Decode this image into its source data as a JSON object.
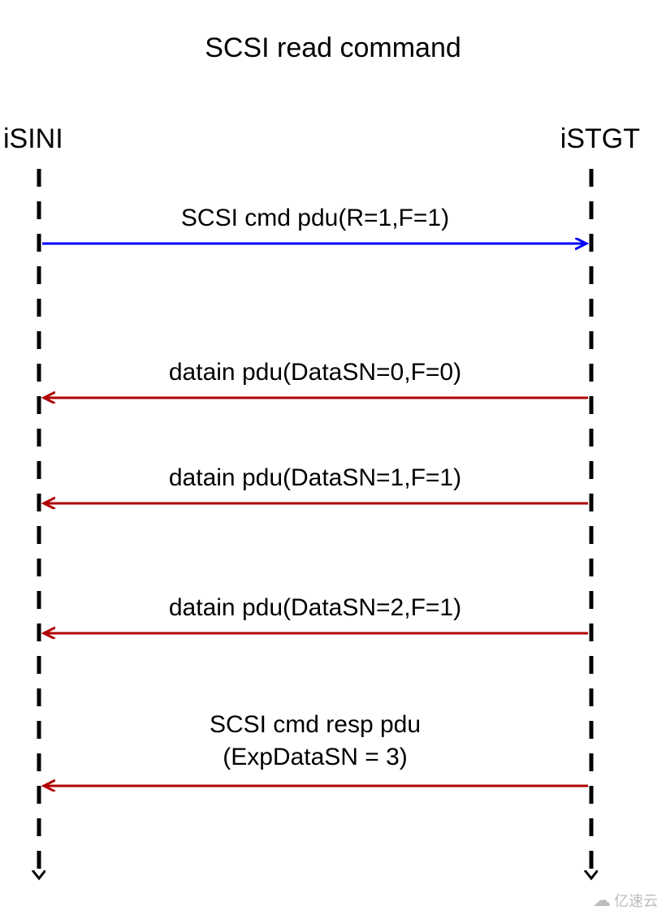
{
  "title": "SCSI read command",
  "actors": {
    "left": "iSINI",
    "right": "iSTGT"
  },
  "messages": {
    "m1": "SCSI cmd pdu(R=1,F=1)",
    "m2": "datain pdu(DataSN=0,F=0)",
    "m3": "datain pdu(DataSN=1,F=1)",
    "m4": "datain pdu(DataSN=2,F=1)",
    "m5a": "SCSI cmd resp pdu",
    "m5b": "(ExpDataSN = 3)"
  },
  "watermark": "亿速云",
  "chart_data": {
    "type": "sequence-diagram",
    "title": "SCSI read command",
    "participants": [
      "iSINI",
      "iSTGT"
    ],
    "messages": [
      {
        "from": "iSINI",
        "to": "iSTGT",
        "label": "SCSI cmd pdu(R=1,F=1)",
        "color": "blue"
      },
      {
        "from": "iSTGT",
        "to": "iSINI",
        "label": "datain pdu(DataSN=0,F=0)",
        "color": "red"
      },
      {
        "from": "iSTGT",
        "to": "iSINI",
        "label": "datain pdu(DataSN=1,F=1)",
        "color": "red"
      },
      {
        "from": "iSTGT",
        "to": "iSINI",
        "label": "datain pdu(DataSN=2,F=1)",
        "color": "red"
      },
      {
        "from": "iSTGT",
        "to": "iSINI",
        "label": "SCSI cmd resp pdu (ExpDataSN = 3)",
        "color": "red"
      }
    ]
  }
}
